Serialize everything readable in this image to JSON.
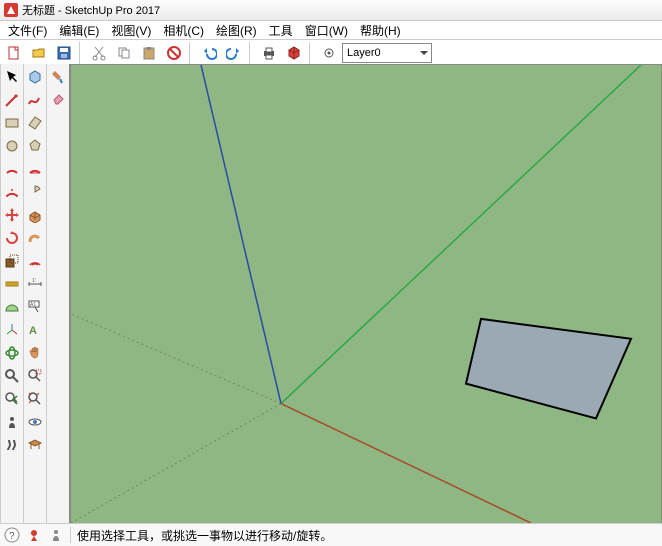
{
  "window": {
    "title": "无标题 - SketchUp Pro 2017"
  },
  "menu": {
    "file": "文件(F)",
    "edit": "编辑(E)",
    "view": "视图(V)",
    "camera": "相机(C)",
    "draw": "绘图(R)",
    "tools": "工具",
    "window": "窗口(W)",
    "help": "帮助(H)"
  },
  "toolbar": {
    "layer_label": "Layer0"
  },
  "status": {
    "hint": "使用选择工具，或挑选一事物以进行移动/旋转。"
  },
  "icons": {
    "new": "new",
    "open": "open",
    "save": "save",
    "cut": "cut",
    "copy": "copy",
    "paste": "paste",
    "delete": "delete",
    "undo": "undo",
    "redo": "redo",
    "print": "print",
    "model": "model",
    "select": "select",
    "make": "make",
    "paint": "paint",
    "eraser": "eraser",
    "line": "line",
    "freehand": "freehand",
    "rect": "rect",
    "rotrect": "rotrect",
    "circle": "circle",
    "polygon": "polygon",
    "arc": "arc",
    "arc2": "arc2",
    "arc3": "arc3",
    "pie": "pie",
    "move": "move",
    "push": "push",
    "rotate": "rotate",
    "follow": "follow",
    "scale": "scale",
    "offset": "offset",
    "tape": "tape",
    "dim": "dim",
    "protractor": "protractor",
    "text": "text",
    "axes": "axes",
    "3dtext": "3dtext",
    "orbit": "orbit",
    "pan": "pan",
    "zoom": "zoom",
    "zoomwin": "zoomwin",
    "prev": "prev",
    "zoomext": "zoomext",
    "position": "position",
    "look": "look",
    "walk": "walk",
    "section": "section"
  }
}
